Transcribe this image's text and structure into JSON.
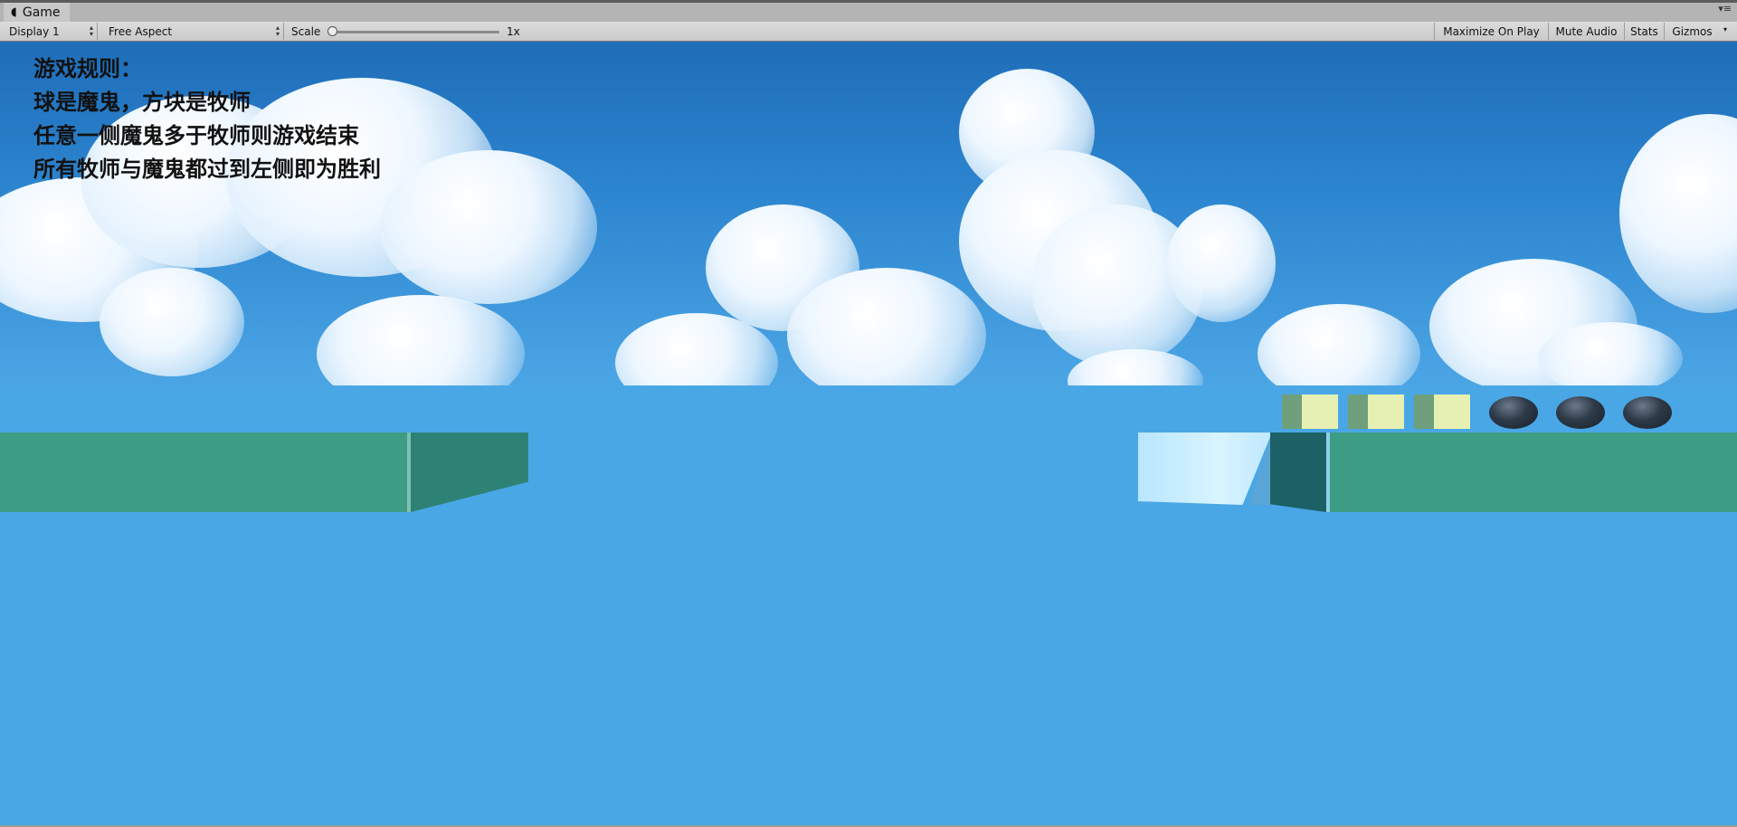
{
  "window": {
    "tab_title": "Game",
    "tab_icon": "pacman-icon"
  },
  "toolbar": {
    "display": "Display 1",
    "aspect": "Free Aspect",
    "scale_label": "Scale",
    "scale_value": "1x",
    "maximize_on_play": "Maximize On Play",
    "mute_audio": "Mute Audio",
    "stats": "Stats",
    "gizmos": "Gizmos"
  },
  "game": {
    "rules": [
      "游戏规则：",
      "球是魔鬼，方块是牧师",
      "任意一侧魔鬼多于牧师则游戏结束",
      "所有牧师与魔鬼都过到左侧即为胜利"
    ],
    "colors": {
      "water": "#4ba6e6",
      "shore": "#3d9c84",
      "priest": "#e7f0b3",
      "devil": "#1e2833"
    },
    "right_shore": {
      "priests": 3,
      "devils": 3
    },
    "left_shore": {
      "priests": 0,
      "devils": 0
    }
  }
}
